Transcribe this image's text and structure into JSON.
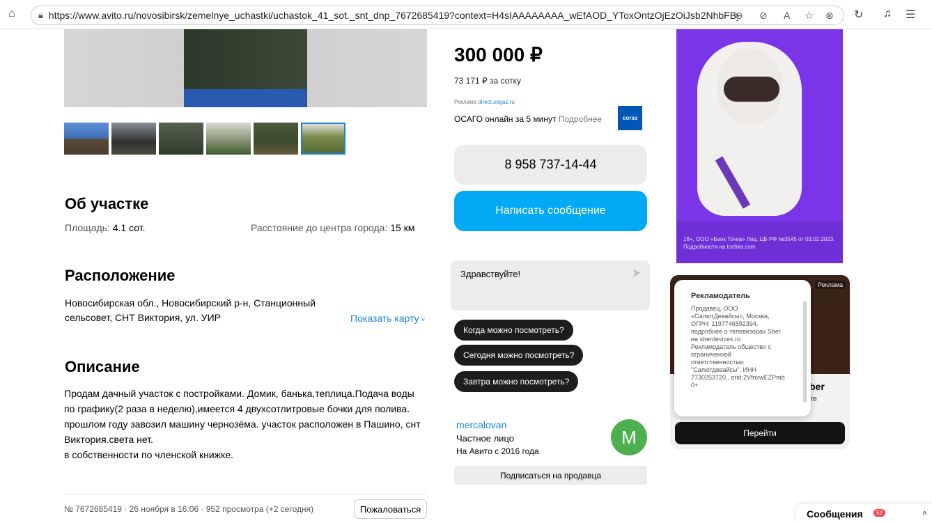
{
  "browser": {
    "url": "https://www.avito.ru/novosibirsk/zemelnye_uchastki/uchastok_41_sot._snt_dnp_7672685419?context=H4sIAAAAAAAA_wEfAOD_YToxOntzOjEzOiJsb2NhbFByaW9yaXR..."
  },
  "listing": {
    "price": "300 000 ₽",
    "price_per": "73 171 ₽ за сотку",
    "about_title": "Об участке",
    "area_label": "Площадь: ",
    "area_value": "4.1 сот.",
    "distance_label": "Расстояние до центра города: ",
    "distance_value": "15 км",
    "location_title": "Расположение",
    "address_line1": "Новосибирская обл., Новосибирский р-н, Станционный",
    "address_line2": "сельсовет, СНТ Виктория, ул. УИР",
    "show_map": "Показать карту",
    "description_title": "Описание",
    "description": [
      "Продам дачный участок с постройками. Домик, банька,теплица.Подача воды",
      "по графику(2 раза в неделю),имеется 4 двухсотлитровые бочки для полива.",
      "прошлом году завозил машину чернозёма. участок расположен в Пашино, снт",
      "Виктория.света нет.",
      "в собственности по членской книжке."
    ],
    "meta": "№ 7672685419 · 26 ноября в 16:06 · 952 просмотра (+2 сегодня)",
    "complain": "Пожаловаться"
  },
  "ad_inline": {
    "label": "Реклама",
    "domain": "direct.sogaz.ru",
    "text": "ОСАГО онлайн за 5 минут",
    "more": "Подробнее",
    "logo": "согаз"
  },
  "contact": {
    "phone": "8 958 737-14-44",
    "write": "Написать сообщение",
    "chat_placeholder": "Здравствуйте!",
    "quick": [
      "Когда можно посмотреть?",
      "Сегодня можно посмотреть?",
      "Завтра можно посмотреть?"
    ]
  },
  "seller": {
    "name": "mercalovan",
    "type": "Частное лицо",
    "since": "На Авито с 2016 года",
    "initial": "M",
    "subscribe": "Подписаться на продавца"
  },
  "banner": {
    "fine_print": "18+, ООО «Банк Точка» Лиц. ЦБ РФ №3545 от 03.02.2023. Подробности на tochka.com"
  },
  "ad2": {
    "badge": "Реклама",
    "title_part": "ber",
    "sub_part": "те",
    "goto": "Перейти",
    "popup_title": "Рекламодатель",
    "popup_text": "Продавец, ООО «СалютДевайсы», Москва, ОГРН: 1197746592394, подробнее о телевизорах Sber на sberdevices.ru  Рекламодатель общество с ограниченной ответственностью \"Салютдевайсы\". ИНН 7730253720., erid:2VfnxwEZPmb 0+"
  },
  "messages": {
    "label": "Сообщения",
    "count": "68"
  },
  "colors": {
    "accent": "#03a9f4",
    "link": "#1a86d6",
    "avatar": "#4caf50",
    "banner": "#7a35e8"
  }
}
